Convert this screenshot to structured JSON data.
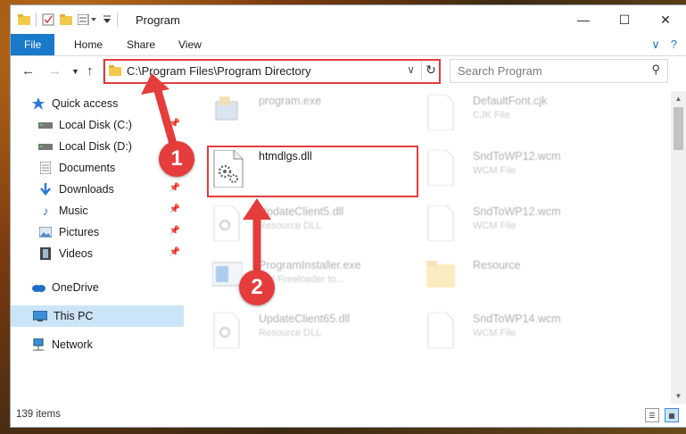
{
  "window": {
    "title": "Program"
  },
  "ribbon": {
    "tabs": [
      "File",
      "Home",
      "Share",
      "View"
    ]
  },
  "address": {
    "path": "C:\\Program Files\\Program Directory"
  },
  "search": {
    "placeholder": "Search Program"
  },
  "sidebar": {
    "items": [
      {
        "label": "Quick access",
        "icon": "star-icon"
      },
      {
        "label": "Local Disk (C:)",
        "icon": "drive-icon"
      },
      {
        "label": "Local Disk (D:)",
        "icon": "drive-icon"
      },
      {
        "label": "Documents",
        "icon": "documents-icon"
      },
      {
        "label": "Downloads",
        "icon": "download-icon"
      },
      {
        "label": "Music",
        "icon": "music-icon"
      },
      {
        "label": "Pictures",
        "icon": "pictures-icon"
      },
      {
        "label": "Videos",
        "icon": "videos-icon"
      },
      {
        "label": "OneDrive",
        "icon": "cloud-icon"
      },
      {
        "label": "This PC",
        "icon": "computer-icon"
      },
      {
        "label": "Network",
        "icon": "network-icon"
      }
    ]
  },
  "files": [
    {
      "name": "program.exe",
      "type": ""
    },
    {
      "name": "DefaultFont.cjk",
      "type": "CJK File"
    },
    {
      "name": "htmdlgs.dll",
      "type": ""
    },
    {
      "name": "SndToWP12.wcm",
      "type": "WCM File"
    },
    {
      "name": "UpdateClient5.dll",
      "type": "Resource DLL"
    },
    {
      "name": "SndToWP12.wcm",
      "type": "WCM File"
    },
    {
      "name": "ProgramInstaller.exe",
      "type": "DIY Freeloader to..."
    },
    {
      "name": "Resource",
      "type": ""
    },
    {
      "name": "UpdateClient65.dll",
      "type": "Resource DLL"
    },
    {
      "name": "SndToWP14.wcm",
      "type": "WCM File"
    }
  ],
  "status": {
    "count": "139 items"
  },
  "annotations": {
    "step1": "1",
    "step2": "2",
    "color": "#e53c3c"
  }
}
